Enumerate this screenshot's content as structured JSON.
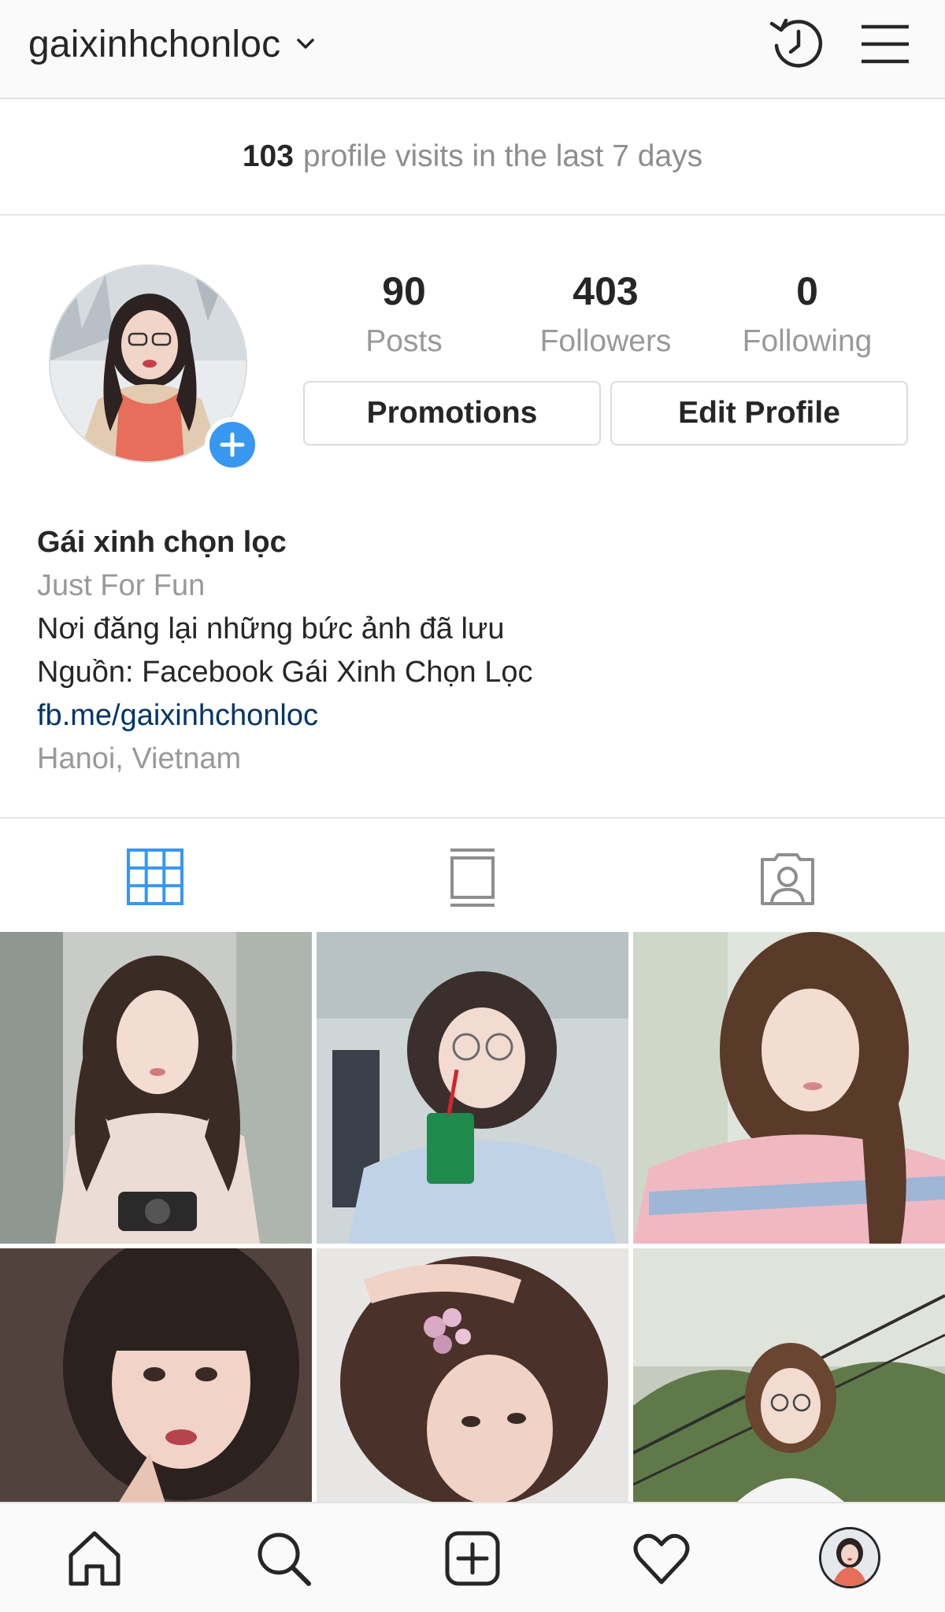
{
  "header": {
    "username": "gaixinhchonloc",
    "icons": {
      "dropdown": "chevron-down-icon",
      "history": "history-icon",
      "menu": "hamburger-menu-icon"
    }
  },
  "visits": {
    "count": "103",
    "text": "profile visits in the last 7 days"
  },
  "stats": {
    "posts": {
      "value": "90",
      "label": "Posts"
    },
    "followers": {
      "value": "403",
      "label": "Followers"
    },
    "following": {
      "value": "0",
      "label": "Following"
    }
  },
  "buttons": {
    "promotions": "Promotions",
    "edit_profile": "Edit Profile"
  },
  "bio": {
    "name": "Gái xinh chọn lọc",
    "category": "Just For Fun",
    "line1": "Nơi đăng lại những bức ảnh đã lưu",
    "line2": "Nguồn: Facebook Gái Xinh Chọn Lọc",
    "link": "fb.me/gaixinhchonloc",
    "location": "Hanoi, Vietnam"
  },
  "tabs": [
    {
      "name": "grid-icon",
      "active": true
    },
    {
      "name": "feed-icon",
      "active": false
    },
    {
      "name": "tagged-icon",
      "active": false
    }
  ],
  "colors": {
    "accent": "#3897f0",
    "link": "#003569",
    "muted": "#999999",
    "text": "#262626"
  },
  "bottom_nav": [
    "home-icon",
    "search-icon",
    "add-post-icon",
    "heart-icon",
    "profile-avatar"
  ]
}
